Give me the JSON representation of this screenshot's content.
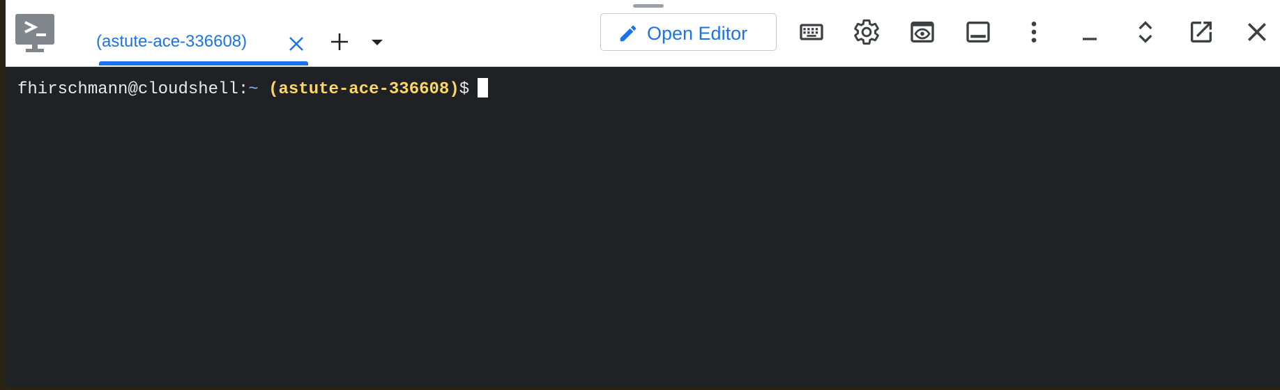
{
  "tab": {
    "label": "(astute-ace-336608)",
    "close_icon": "close-icon"
  },
  "toolbar": {
    "add_tab_icon": "plus-icon",
    "dropdown_icon": "caret-down-icon",
    "open_editor_label": "Open Editor",
    "open_editor_icon": "pencil-icon",
    "buttons": [
      "keyboard-icon",
      "gear-icon",
      "web-preview-icon",
      "panel-icon",
      "more-vert-icon",
      "minimize-icon",
      "expand-icon",
      "open-new-window-icon",
      "close-icon"
    ]
  },
  "terminal": {
    "user_host": "fhirschmann@cloudshell:",
    "path": "~",
    "project": "(astute-ace-336608)",
    "symbol": "$"
  },
  "colors": {
    "accent": "#1a73e8",
    "terminal_bg": "#202124",
    "project_yellow": "#fdd663",
    "path_blue": "#8ab4f8"
  }
}
